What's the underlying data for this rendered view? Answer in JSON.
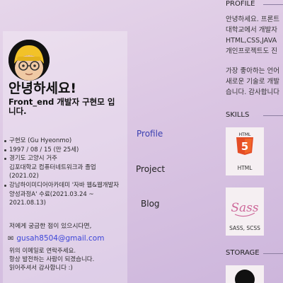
{
  "profile": {
    "greeting": "안녕하세요!",
    "intro": "Front_end 개발자 구현모 입니다.",
    "info": [
      {
        "text": "구현모 (Gu Hyeonmo)",
        "bullet": true
      },
      {
        "text": "1997 / 08 / 15 (만 25세)",
        "bullet": true
      },
      {
        "text": "경기도 고양시 거주",
        "bullet": true
      },
      {
        "text": "김포대학교 컴퓨터네트워크과 졸업",
        "bullet": false
      },
      {
        "text": "(2021.02)",
        "bullet": false
      },
      {
        "text": "강남하이미디어아카데미 '자바 웹&웹개발자",
        "bullet": true
      },
      {
        "text": "양성과정A' 수료(2021.03.24 ~",
        "bullet": false
      },
      {
        "text": "2021.08.13)",
        "bullet": false
      }
    ],
    "contact_note": "저에게 궁금한 점이 있으시다면,",
    "email": "gusah8504@gmail.com",
    "outro": [
      "위의 이메일로 연락주세요.",
      "항상 발전하는 사람이 되겠습니다.",
      "읽어주셔서 감사합니다 :)"
    ]
  },
  "nav": {
    "profile": "Profile",
    "project": "Project",
    "blog": "Blog"
  },
  "right": {
    "profile_title": "PROFILE",
    "about": [
      [
        "안녕하세요. 프론트",
        "대학교에서 개발자",
        "HTML,CSS,JAVA",
        "개인프로젝트도 진"
      ],
      [
        "가장 좋아하는 언어",
        "새로운 기술로 개발",
        "습니다. 감사합니다"
      ]
    ],
    "skills_title": "SKILLS",
    "skills": [
      {
        "name": "HTML",
        "icon": "html5-icon",
        "color": "#e44d26",
        "badge": "5"
      },
      {
        "name": "SASS, SCSS",
        "icon": "sass-icon",
        "color": "#cd6799",
        "badge": "Sass"
      }
    ],
    "storage_title": "STORAGE",
    "storage": [
      {
        "icon": "github-icon"
      }
    ]
  },
  "colors": {
    "accent": "#3a3fb0",
    "link": "#3c45d8"
  }
}
